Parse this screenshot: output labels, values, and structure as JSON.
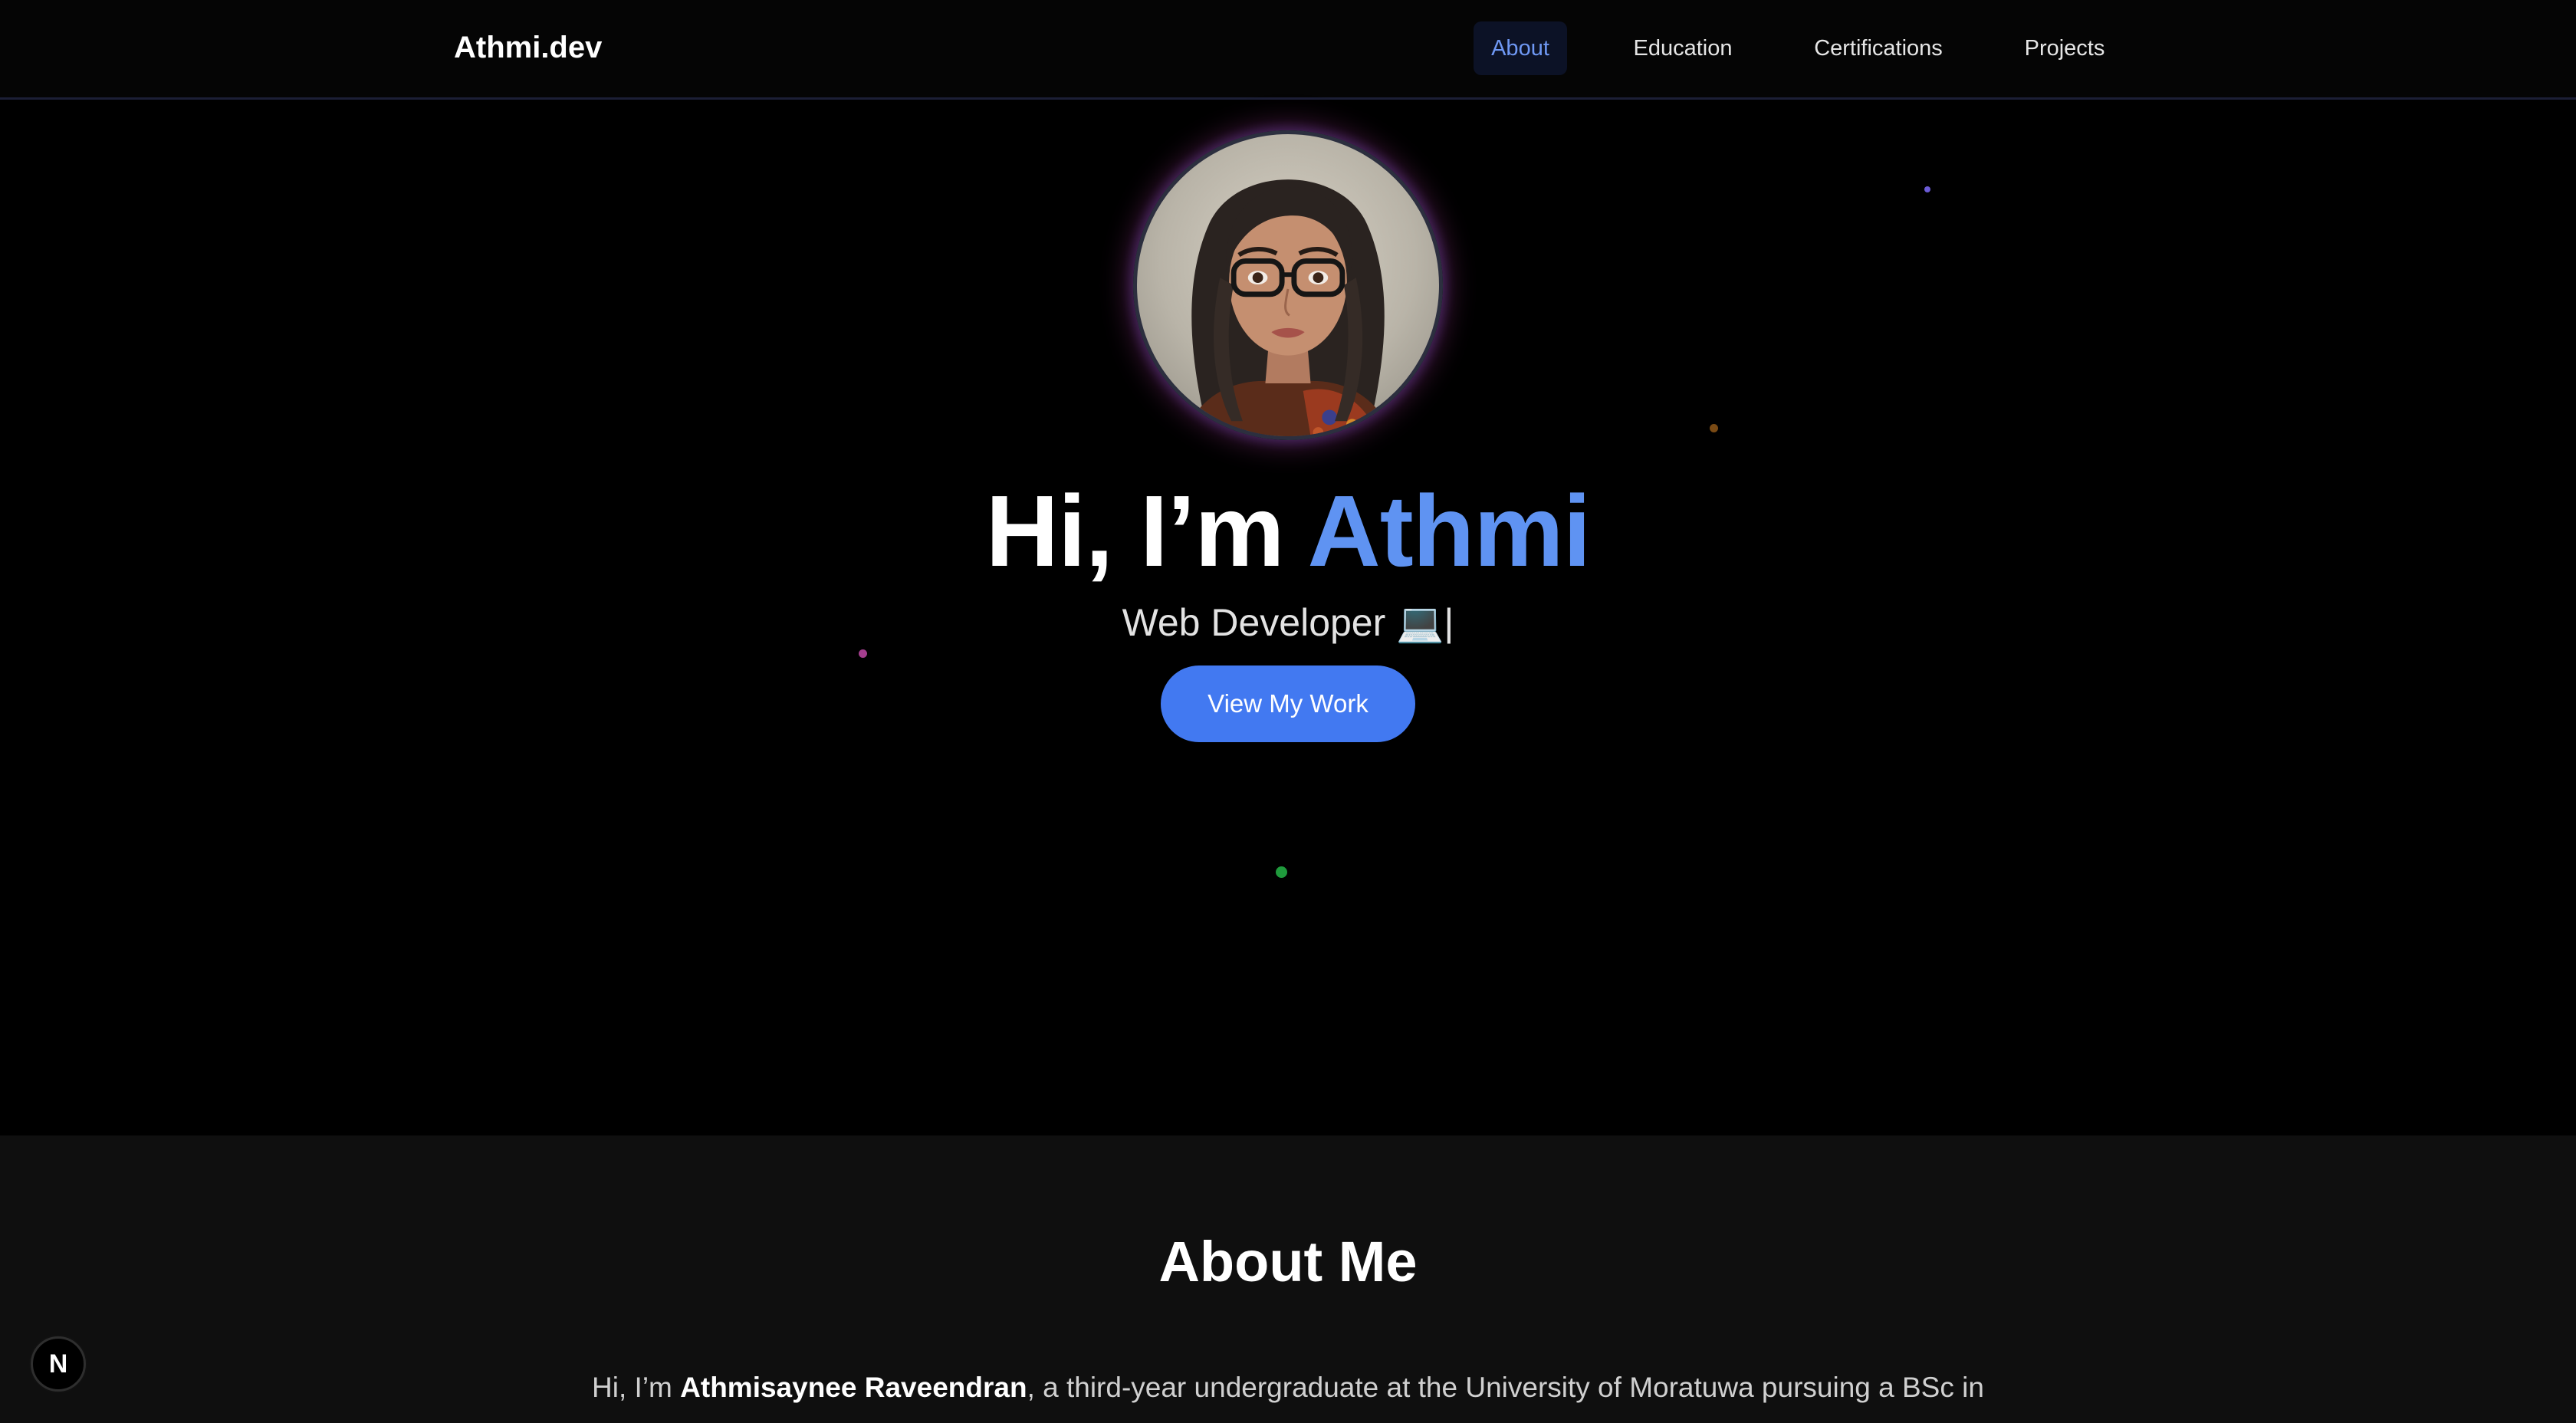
{
  "header": {
    "brand": "Athmi.dev",
    "nav": [
      {
        "label": "About",
        "active": true
      },
      {
        "label": "Education",
        "active": false
      },
      {
        "label": "Certifications",
        "active": false
      },
      {
        "label": "Projects",
        "active": false
      }
    ]
  },
  "hero": {
    "greeting": "Hi, I’m",
    "name": "Athmi",
    "subtitle": "Web Developer 💻",
    "cursor": "|",
    "cta_label": "View My Work",
    "avatar_icon": "portrait-avatar"
  },
  "about": {
    "title": "About Me",
    "intro_prefix": "Hi, I’m ",
    "full_name": "Athmisaynee Raveendran",
    "intro_suffix": ", a third-year undergraduate at the University of Moratuwa pursuing a BSc in"
  },
  "badge": {
    "label": "N",
    "icon": "nextjs-icon"
  },
  "colors": {
    "accent": "#5f93f2",
    "button": "#4279f1",
    "background": "#000000",
    "section_background": "#0f0f0f",
    "active_nav_bg": "#0c1226"
  }
}
